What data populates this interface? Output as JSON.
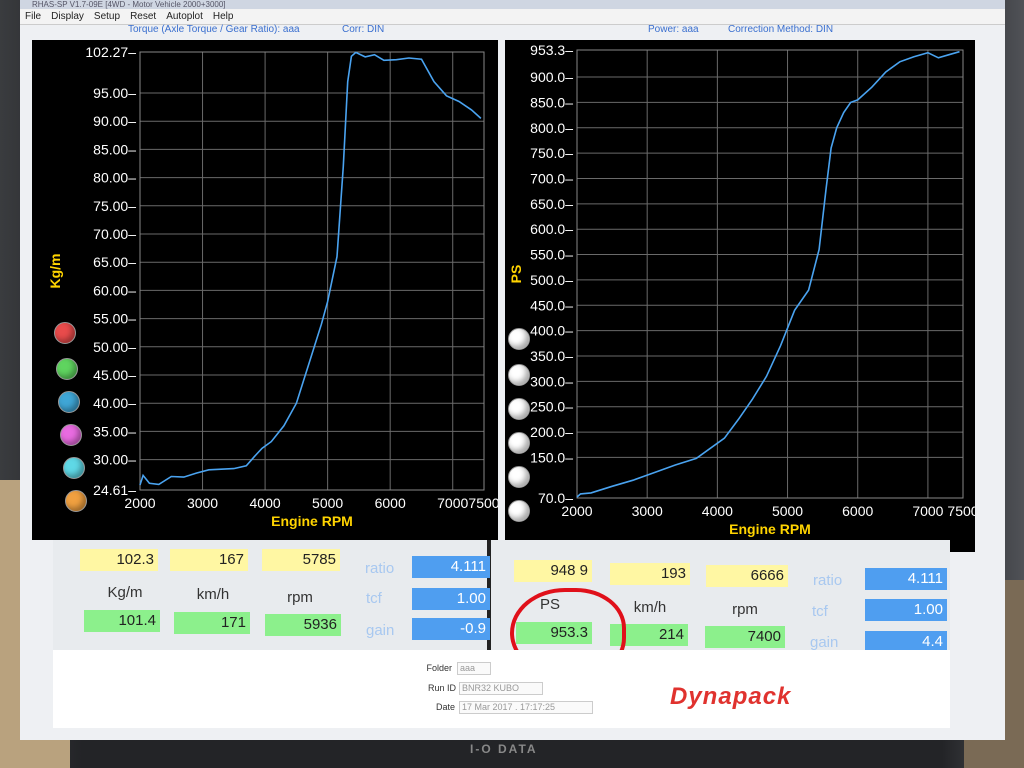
{
  "window": {
    "title": "RHAS-SP V1.7-09E  [4WD - Motor Vehicle 2000+3000]"
  },
  "menu": [
    "File",
    "Display",
    "Setup",
    "Reset",
    "Autoplot",
    "Help"
  ],
  "header": {
    "torque": "Torque (Axle Torque / Gear Ratio): aaa",
    "corr": "Corr: DIN",
    "power": "Power: aaa",
    "correction": "Correction Method: DIN"
  },
  "chart_data": [
    {
      "type": "line",
      "xlabel": "Engine RPM",
      "ylabel": "Kg/m",
      "xlim": [
        2000,
        7500
      ],
      "ylim": [
        24.61,
        102.27
      ],
      "yticks": [
        "102.27",
        "95.00",
        "90.00",
        "85.00",
        "80.00",
        "75.00",
        "70.00",
        "65.00",
        "60.00",
        "55.00",
        "50.00",
        "45.00",
        "40.00",
        "35.00",
        "30.00",
        "24.61"
      ],
      "xticks": [
        "2000",
        "3000",
        "4000",
        "5000",
        "6000",
        "7000",
        "7500"
      ],
      "series": [
        {
          "color": "#4aa3f0",
          "x": [
            2000,
            2050,
            2150,
            2300,
            2500,
            2700,
            2900,
            3100,
            3300,
            3500,
            3700,
            3850,
            3950,
            4100,
            4300,
            4500,
            4700,
            4900,
            5000,
            5150,
            5250,
            5320,
            5380,
            5450,
            5600,
            5750,
            5900,
            6100,
            6300,
            6500,
            6700,
            6900,
            7100,
            7300,
            7450
          ],
          "y": [
            25.5,
            27.2,
            25.8,
            25.6,
            27.0,
            26.9,
            27.6,
            28.2,
            28.3,
            28.4,
            28.9,
            30.8,
            32.0,
            33.2,
            36.0,
            40.0,
            47.0,
            54.0,
            58.0,
            66.0,
            82.0,
            97.0,
            101.5,
            102.2,
            101.4,
            101.8,
            100.8,
            100.9,
            101.2,
            101.0,
            97.0,
            94.5,
            93.5,
            92.0,
            90.5
          ]
        }
      ]
    },
    {
      "type": "line",
      "xlabel": "Engine RPM",
      "ylabel": "PS",
      "xlim": [
        2000,
        7500
      ],
      "ylim": [
        70.0,
        953.3
      ],
      "yticks": [
        "953.3",
        "900.0",
        "850.0",
        "800.0",
        "750.0",
        "700.0",
        "650.0",
        "600.0",
        "550.0",
        "500.0",
        "450.0",
        "400.0",
        "350.0",
        "300.0",
        "250.0",
        "200.0",
        "150.0",
        "70.0"
      ],
      "xticks": [
        "2000",
        "3000",
        "4000",
        "5000",
        "6000",
        "7000",
        "7500"
      ],
      "series": [
        {
          "color": "#4aa3f0",
          "x": [
            2000,
            2050,
            2200,
            2500,
            2800,
            3100,
            3400,
            3700,
            3900,
            4100,
            4300,
            4500,
            4700,
            4900,
            5100,
            5300,
            5450,
            5550,
            5620,
            5700,
            5800,
            5900,
            6000,
            6200,
            6400,
            6600,
            6800,
            7000,
            7150,
            7300,
            7450
          ],
          "y": [
            72,
            78,
            80,
            93,
            105,
            120,
            135,
            148,
            168,
            188,
            225,
            265,
            310,
            370,
            440,
            480,
            560,
            680,
            760,
            800,
            830,
            850,
            855,
            880,
            910,
            930,
            940,
            948,
            938,
            944,
            950
          ]
        }
      ]
    }
  ],
  "left_panel": {
    "top_values": [
      "102.3",
      "167",
      "5785"
    ],
    "labels": [
      "Kg/m",
      "km/h",
      "rpm"
    ],
    "bottom_values": [
      "101.4",
      "171",
      "5936"
    ],
    "side": {
      "ratio_label": "ratio",
      "ratio": "4.111",
      "tcf_label": "tcf",
      "tcf": "1.00",
      "gain_label": "gain",
      "gain": "-0.9"
    }
  },
  "right_panel": {
    "top_values": [
      "948 9",
      "193",
      "6666"
    ],
    "labels": [
      "PS",
      "km/h",
      "rpm"
    ],
    "bottom_values": [
      "953.3",
      "214",
      "7400"
    ],
    "side": {
      "ratio_label": "ratio",
      "ratio": "4.111",
      "tcf_label": "tcf",
      "tcf": "1.00",
      "gain_label": "gain",
      "gain": "4.4"
    }
  },
  "footer": {
    "folder_label": "Folder",
    "folder_value": "aaa",
    "run_label": "Run ID",
    "run_value": "BNR32 KUBO",
    "date_label": "Date",
    "date_value": "17 Mar 2017 . 17:17:25",
    "logo": "Dynapack"
  },
  "monitor_brand": "I-O DATA",
  "colors": {
    "dot_left": [
      "#e84b4b",
      "#5fd45f",
      "#3fa6d6",
      "#e86be0",
      "#5fd8e6",
      "#f0a040"
    ],
    "dot_right": "#ffffff",
    "annotation": "#e0101a"
  }
}
